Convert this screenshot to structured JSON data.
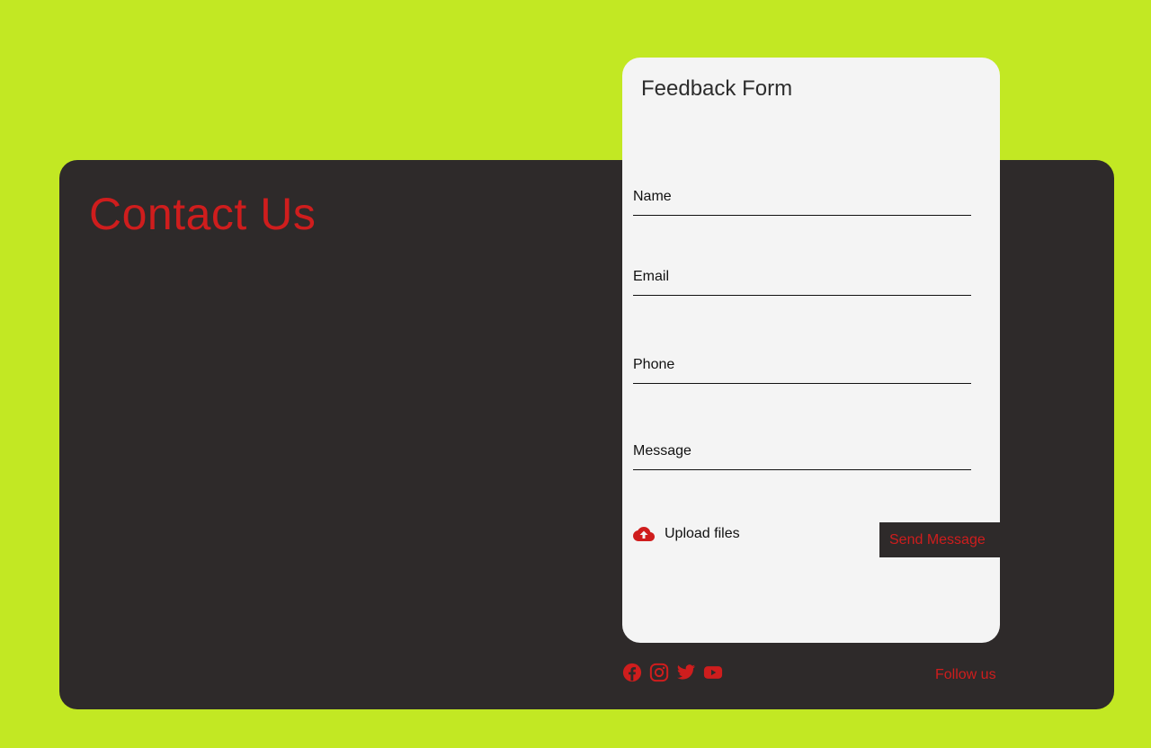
{
  "page": {
    "title": "Contact Us"
  },
  "form": {
    "title": "Feedback Form",
    "fields": [
      {
        "label": "Name",
        "value": ""
      },
      {
        "label": "Email",
        "value": ""
      },
      {
        "label": "Phone",
        "value": ""
      },
      {
        "label": "Message",
        "value": ""
      }
    ],
    "upload_label": "Upload files",
    "submit_label": "Send Message"
  },
  "footer": {
    "follow_label": "Follow us",
    "socials": [
      "facebook-icon",
      "instagram-icon",
      "twitter-icon",
      "youtube-icon"
    ]
  },
  "colors": {
    "background": "#c2e823",
    "panel": "#2e2a2a",
    "card": "#f4f4f4",
    "accent": "#cf1d1d"
  }
}
